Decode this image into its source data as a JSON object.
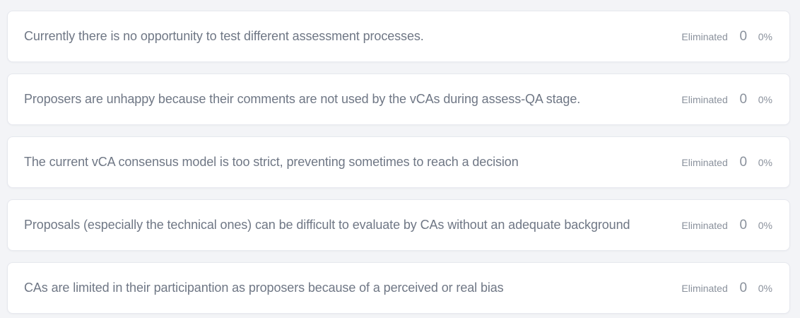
{
  "items": [
    {
      "text": "Currently there is no opportunity to test different assessment processes.",
      "status": "Eliminated",
      "count": "0",
      "percent": "0%"
    },
    {
      "text": "Proposers are unhappy because their comments are not used by the vCAs during assess-QA stage.",
      "status": "Eliminated",
      "count": "0",
      "percent": "0%"
    },
    {
      "text": "The current vCA consensus model is too strict, preventing sometimes to reach a decision",
      "status": "Eliminated",
      "count": "0",
      "percent": "0%"
    },
    {
      "text": "Proposals (especially the technical ones) can be difficult to evaluate by CAs without an adequate background",
      "status": "Eliminated",
      "count": "0",
      "percent": "0%"
    },
    {
      "text": "CAs are limited in their participantion as proposers because of a perceived or real bias",
      "status": "Eliminated",
      "count": "0",
      "percent": "0%"
    }
  ]
}
